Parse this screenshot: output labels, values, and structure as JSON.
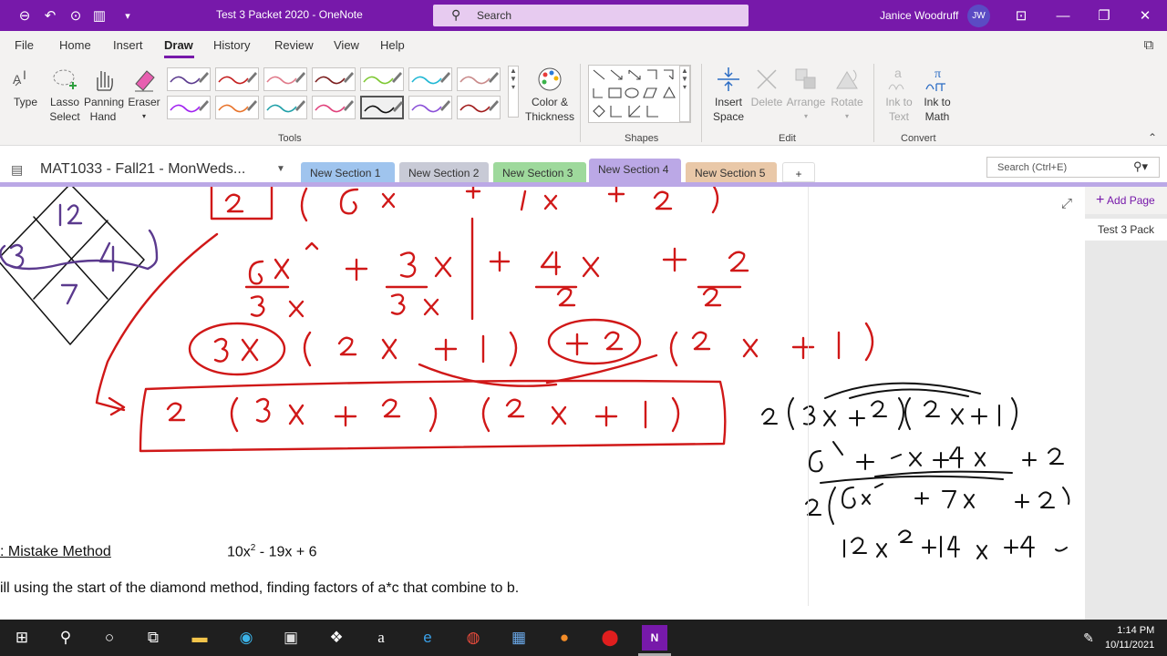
{
  "titlebar": {
    "title": "Test 3 Packet 2020  -  OneNote",
    "search_placeholder": "Search",
    "user_name": "Janice Woodruff",
    "user_initials": "JW",
    "accent": "#7719aa"
  },
  "menu": [
    "File",
    "Home",
    "Insert",
    "Draw",
    "History",
    "Review",
    "View",
    "Help"
  ],
  "ribbon": {
    "tools": {
      "type": "Type",
      "lasso": "Lasso",
      "select": "Select",
      "panning": "Panning",
      "hand": "Hand",
      "eraser": "Eraser",
      "color": "Color &",
      "thickness": "Thickness",
      "label": "Tools"
    },
    "shapes": {
      "label": "Shapes"
    },
    "edit": {
      "insert": "Insert",
      "space": "Space",
      "delete": "Delete",
      "arrange": "Arrange",
      "rotate": "Rotate",
      "label": "Edit"
    },
    "convert": {
      "ink_to": "Ink to",
      "text": "Text",
      "math": "Math",
      "label": "Convert"
    },
    "pen_colors": [
      "#5b3a8e",
      "#c41e1e",
      "#e07a8a",
      "#7b1d1d",
      "#7ec832",
      "#1fb7d4",
      "#c98a8a",
      "#a020f0",
      "#e8732a",
      "#1fa0a8",
      "#e0407a",
      "#111111",
      "#8a4fd8",
      "#a01a1a"
    ]
  },
  "sections": {
    "notebook": "MAT1033 - Fall21 - MonWeds...",
    "tabs": [
      {
        "label": "New Section 1",
        "color": "#9fc4ee"
      },
      {
        "label": "New Section 2",
        "color": "#c8cad6"
      },
      {
        "label": "New Section 3",
        "color": "#9ed99c"
      },
      {
        "label": "New Section 4",
        "color": "#bba8e6"
      },
      {
        "label": "New Section 5",
        "color": "#e9c8a8"
      }
    ],
    "add_tab": "+",
    "search_placeholder": "Search (Ctrl+E)"
  },
  "pages": {
    "add_page": "Add Page",
    "items": [
      "Test 3 Pack"
    ]
  },
  "canvas": {
    "diamond_top": "12",
    "diamond_left": "3",
    "diamond_right": "4",
    "diamond_bottom": "7",
    "heading": ": Mistake Method",
    "expression_base": "10x",
    "expression_exp": "2",
    "expression_rest": " - 19x + 6",
    "line_text": "ill using the start of the diamond method, finding factors of a*c that combine to b."
  },
  "taskbar": {
    "time": "1:14 PM",
    "date": "10/11/2021"
  }
}
